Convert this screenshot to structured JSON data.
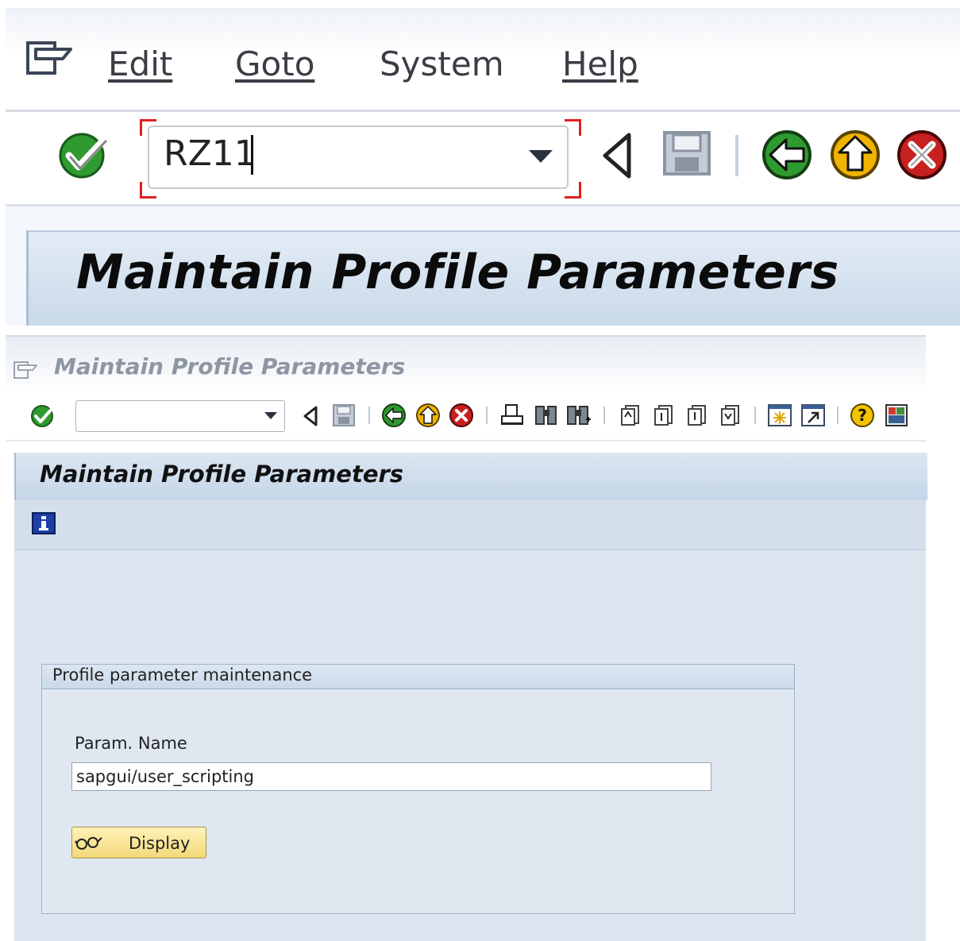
{
  "zoomed_panel": {
    "menu": [
      {
        "label": "Edit"
      },
      {
        "label": "Goto"
      },
      {
        "label": "System"
      },
      {
        "label": "Help"
      }
    ],
    "command_field_value": "RZ11",
    "screen_title": "Maintain Profile Parameters",
    "icons": [
      "menu-icon",
      "enter-icon",
      "dropdown-arrow-icon",
      "history-back-icon",
      "save-icon",
      "back-icon",
      "exit-icon",
      "cancel-icon"
    ]
  },
  "window": {
    "title": "Maintain Profile Parameters",
    "screen_title": "Maintain Profile Parameters",
    "command_field_value": "",
    "toolbar_icons": [
      "enter-icon",
      "history-back-icon",
      "save-icon",
      "back-icon",
      "exit-icon",
      "cancel-icon",
      "print-icon",
      "find-icon",
      "find-next-icon",
      "first-page-icon",
      "previous-page-icon",
      "next-page-icon",
      "last-page-icon",
      "create-session-icon",
      "generate-shortcut-icon",
      "help-icon",
      "layout-menu-icon"
    ],
    "application_toolbar_icons": [
      "info-icon"
    ],
    "group_box": {
      "title": "Profile parameter maintenance",
      "param_label": "Param. Name",
      "param_value": "sapgui/user_scripting",
      "display_button": "Display"
    }
  },
  "colors": {
    "accent_red": "#e02020",
    "enter_green": "#2f9a2f",
    "exit_yellow": "#f0b400",
    "cancel_red": "#c82020",
    "title_bar": "#c9d9ea",
    "screen_bg": "#dde6f0",
    "button_yellow": "#f3d97a"
  }
}
